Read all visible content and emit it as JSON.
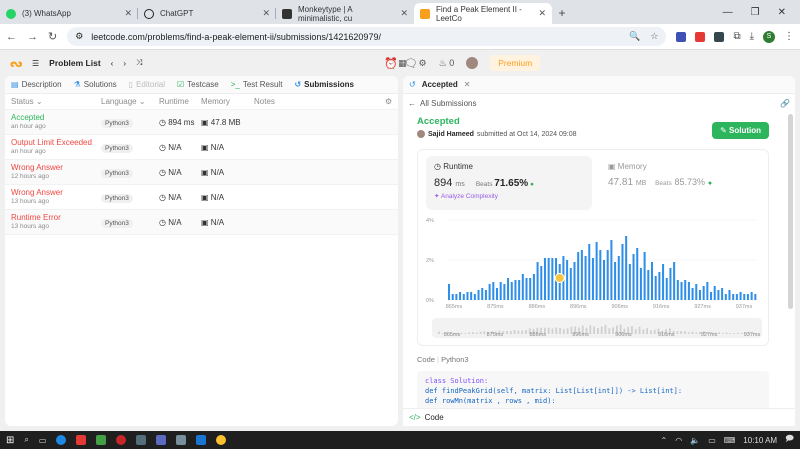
{
  "browser": {
    "tabs": [
      {
        "title": "(3) WhatsApp",
        "color": "#25d366"
      },
      {
        "title": "ChatGPT",
        "color": "#222222"
      },
      {
        "title": "Monkeytype | A minimalistic, cu",
        "color": "#333333"
      },
      {
        "title": "Find a Peak Element II - LeetCo",
        "color": "#f89f1b"
      }
    ],
    "url": "leetcode.com/problems/find-a-peak-element-ii/submissions/1421620979/",
    "profile_initial": "S"
  },
  "topbar": {
    "problem_list": "Problem List",
    "dots": "88",
    "streak": "0",
    "premium": "Premium"
  },
  "left_tabs": [
    "Description",
    "Solutions",
    "Editorial",
    "Testcase",
    "Test Result",
    "Submissions"
  ],
  "table": {
    "headers": [
      "Status",
      "Language",
      "Runtime",
      "Memory",
      "Notes"
    ],
    "rows": [
      {
        "status": "Accepted",
        "time": "an hour ago",
        "lang": "Python3",
        "runtime": "894 ms",
        "memory": "47.8 MB",
        "kind": "acc"
      },
      {
        "status": "Output Limit Exceeded",
        "time": "an hour ago",
        "lang": "Python3",
        "runtime": "N/A",
        "memory": "N/A",
        "kind": "err"
      },
      {
        "status": "Wrong Answer",
        "time": "12 hours ago",
        "lang": "Python3",
        "runtime": "N/A",
        "memory": "N/A",
        "kind": "err"
      },
      {
        "status": "Wrong Answer",
        "time": "13 hours ago",
        "lang": "Python3",
        "runtime": "N/A",
        "memory": "N/A",
        "kind": "err"
      },
      {
        "status": "Runtime Error",
        "time": "13 hours ago",
        "lang": "Python3",
        "runtime": "N/A",
        "memory": "N/A",
        "kind": "err"
      }
    ]
  },
  "right": {
    "tab": "Accepted",
    "back": "All Submissions",
    "status": "Accepted",
    "user": "Sajid Hameed",
    "submitted": "submitted at Oct 14, 2024 09:08",
    "solution_btn": "Solution",
    "runtime_label": "Runtime",
    "runtime_value": "894",
    "runtime_unit": "ms",
    "beats_label": "Beats",
    "runtime_beats": "71.65%",
    "analyze": "Analyze Complexity",
    "memory_label": "Memory",
    "memory_value": "47.81",
    "memory_unit": "MB",
    "memory_beats": "85.73%",
    "code_label": "Code",
    "code_lang": "Python3",
    "code_lines": [
      "class Solution:",
      "    def findPeakGrid(self, matrix: List[List[int]]) -> List[int]:",
      "        def rowMn(matrix , rows , mid):"
    ],
    "footer": "Code"
  },
  "chart_data": {
    "type": "bar",
    "ylabel_ticks": [
      "4%",
      "2%",
      "0%"
    ],
    "ylim": [
      0,
      4
    ],
    "x_ticks": [
      "865ms",
      "875ms",
      "886ms",
      "896ms",
      "906ms",
      "916ms",
      "927ms",
      "937ms"
    ],
    "values": [
      0.8,
      0.3,
      0.3,
      0.4,
      0.3,
      0.4,
      0.4,
      0.3,
      0.5,
      0.6,
      0.5,
      0.8,
      0.9,
      0.6,
      0.9,
      0.8,
      1.1,
      0.9,
      1.0,
      1.0,
      1.3,
      1.1,
      1.1,
      1.3,
      1.9,
      1.7,
      2.1,
      2.1,
      2.1,
      2.1,
      1.8,
      2.2,
      2.0,
      1.6,
      1.9,
      2.4,
      2.5,
      2.2,
      2.8,
      2.1,
      2.9,
      2.5,
      2.0,
      2.5,
      3.0,
      1.9,
      2.2,
      2.8,
      3.2,
      1.8,
      2.3,
      2.6,
      1.6,
      2.4,
      1.5,
      1.9,
      1.2,
      1.4,
      1.8,
      1.1,
      1.6,
      1.9,
      1.0,
      0.9,
      1.0,
      0.9,
      0.6,
      0.8,
      0.5,
      0.7,
      0.9,
      0.4,
      0.7,
      0.5,
      0.6,
      0.3,
      0.5,
      0.3,
      0.3,
      0.4,
      0.3,
      0.3,
      0.4,
      0.3
    ],
    "highlight_index": 30,
    "bar_color": "#2f8fe8"
  },
  "taskbar": {
    "clock": "10:10 AM"
  }
}
